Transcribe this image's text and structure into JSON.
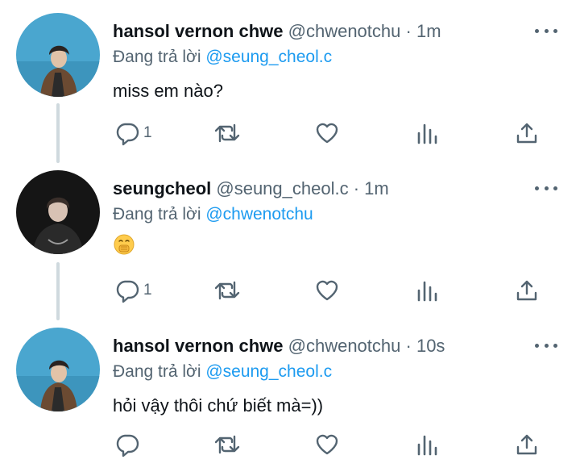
{
  "colors": {
    "text": "#0f1419",
    "secondary": "#536471",
    "accent": "#1d9bf0",
    "thread_line": "#cfd9de"
  },
  "tweets": [
    {
      "name": "hansol vernon chwe",
      "handle": "@chwenotchu",
      "dot": "·",
      "time": "1m",
      "reply_prefix": "Đang trả lời ",
      "reply_mention": "@seung_cheol.c",
      "text": "miss em nào?",
      "emoji": "",
      "reply_count": "1",
      "avatar_icon": "profile-photo"
    },
    {
      "name": "seungcheol",
      "handle": "@seung_cheol.c",
      "dot": "·",
      "time": "1m",
      "reply_prefix": "Đang trả lời ",
      "reply_mention": "@chwenotchu",
      "text": "",
      "emoji": "face-with-hand-over-mouth",
      "reply_count": "1",
      "avatar_icon": "profile-photo"
    },
    {
      "name": "hansol vernon chwe",
      "handle": "@chwenotchu",
      "dot": "·",
      "time": "10s",
      "reply_prefix": "Đang trả lời ",
      "reply_mention": "@seung_cheol.c",
      "text": "hỏi vậy thôi chứ biết mà=))",
      "emoji": "",
      "reply_count": "",
      "avatar_icon": "profile-photo"
    }
  ]
}
